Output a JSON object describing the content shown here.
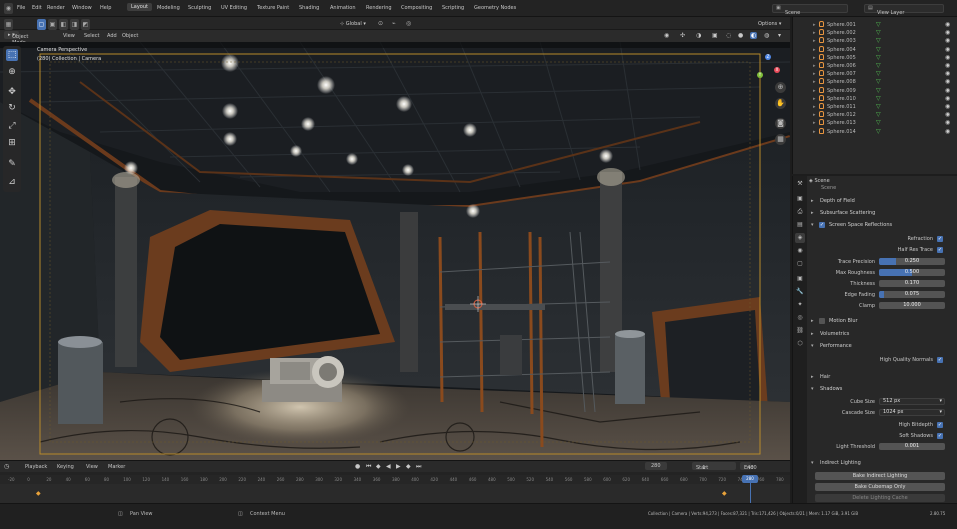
{
  "menu": [
    "File",
    "Edit",
    "Render",
    "Window",
    "Help"
  ],
  "workspaces": [
    "Layout",
    "Modeling",
    "Sculpting",
    "UV Editing",
    "Texture Paint",
    "Shading",
    "Animation",
    "Rendering",
    "Compositing",
    "Scripting",
    "Geometry Nodes"
  ],
  "active_workspace": "Layout",
  "scene_field": "Scene",
  "view_layer_field": "View Layer",
  "viewport": {
    "mode": "Object Mode",
    "menus": [
      "View",
      "Select",
      "Add",
      "Object"
    ],
    "transform_orientation": "Global",
    "options": "Options",
    "overlay_title": "Camera Perspective",
    "overlay_subtitle": "(280) Collection | Camera"
  },
  "gizmo": {
    "x": "X",
    "y": "Y",
    "z": "Z"
  },
  "outliner": {
    "items": [
      "Sphere.001",
      "Sphere.002",
      "Sphere.003",
      "Sphere.004",
      "Sphere.005",
      "Sphere.006",
      "Sphere.007",
      "Sphere.008",
      "Sphere.009",
      "Sphere.010",
      "Sphere.011",
      "Sphere.012",
      "Sphere.013",
      "Sphere.014"
    ]
  },
  "properties": {
    "breadcrumb": "Scene",
    "breadcrumb_sub": "Scene",
    "sections": {
      "depth_of_field": "Depth of Field",
      "subsurface": "Subsurface Scattering",
      "ssr": "Screen Space Reflections",
      "motion_blur": "Motion Blur",
      "volumetrics": "Volumetrics",
      "performance": "Performance",
      "hair": "Hair",
      "shadows": "Shadows",
      "indirect": "Indirect Lighting"
    },
    "ssr_fields": {
      "refraction": "Refraction",
      "half_res": "Half Res Trace",
      "trace_precision": {
        "label": "Trace Precision",
        "value": "0.250",
        "fill": 0.25
      },
      "max_roughness": {
        "label": "Max Roughness",
        "value": "0.500",
        "fill": 0.5
      },
      "thickness": {
        "label": "Thickness",
        "value": "0.170",
        "fill": 0.0
      },
      "edge_fading": {
        "label": "Edge Fading",
        "value": "0.075",
        "fill": 0.075
      },
      "clamp": {
        "label": "Clamp",
        "value": "10.000",
        "fill": 0.0
      }
    },
    "high_quality_normals": "High Quality Normals",
    "shadows_fields": {
      "cube_size": {
        "label": "Cube Size",
        "value": "512 px"
      },
      "cascade_size": {
        "label": "Cascade Size",
        "value": "1024 px"
      },
      "high_bitdepth": "High Bitdepth",
      "soft_shadows": "Soft Shadows",
      "light_threshold": {
        "label": "Light Threshold",
        "value": "0.001"
      }
    },
    "indirect_buttons": [
      "Bake Indirect Lighting",
      "Bake Cubemap Only",
      "Delete Lighting Cache"
    ]
  },
  "timeline": {
    "menus": [
      "Playback",
      "Keying",
      "View",
      "Marker"
    ],
    "current_frame": "280",
    "start_label": "Start",
    "start": "1",
    "end_label": "End",
    "end": "400",
    "ruler": [
      "-20",
      "0",
      "20",
      "40",
      "60",
      "80",
      "100",
      "120",
      "140",
      "160",
      "180",
      "200",
      "220",
      "240",
      "260",
      "280",
      "300",
      "320",
      "340",
      "360",
      "380",
      "400",
      "420",
      "440",
      "460",
      "480",
      "500",
      "520",
      "540",
      "560",
      "580",
      "600",
      "620",
      "640",
      "660",
      "680",
      "700",
      "720",
      "740",
      "760",
      "780"
    ],
    "current_marker": "280"
  },
  "status_bar": {
    "left": "Pan View",
    "middle": "Context Menu",
    "right": "Collection | Camera | Verts:94,273 | Faces:87,321 | Tris:171,426 | Objects:0/21 | Mem: 1.17 GiB, 3.91 GiB",
    "version": "2.80.75"
  }
}
